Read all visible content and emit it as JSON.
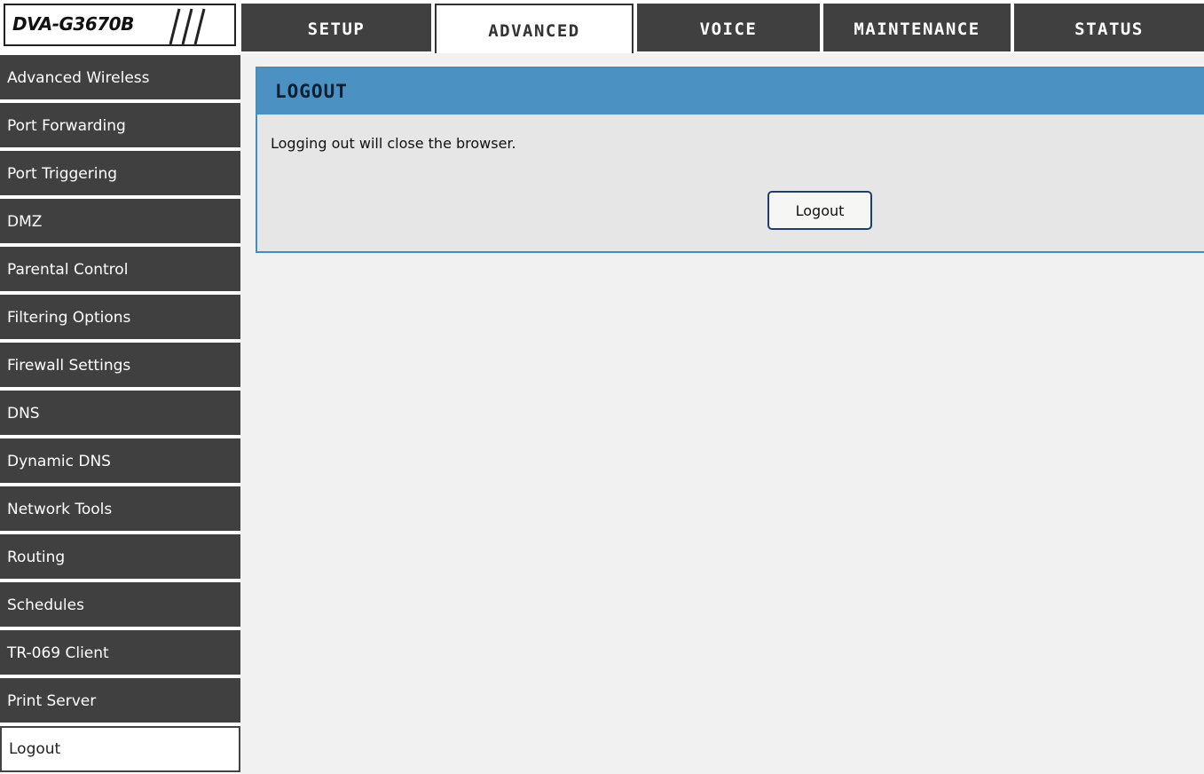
{
  "header": {
    "logo_text": "DVA-G3670B",
    "tabs": [
      {
        "label": "SETUP",
        "active": false
      },
      {
        "label": "ADVANCED",
        "active": true
      },
      {
        "label": "VOICE",
        "active": false
      },
      {
        "label": "MAINTENANCE",
        "active": false
      },
      {
        "label": "STATUS",
        "active": false
      }
    ]
  },
  "sidebar": {
    "items": [
      {
        "label": "Advanced Wireless",
        "active": false
      },
      {
        "label": "Port Forwarding",
        "active": false
      },
      {
        "label": "Port Triggering",
        "active": false
      },
      {
        "label": "DMZ",
        "active": false
      },
      {
        "label": "Parental Control",
        "active": false
      },
      {
        "label": "Filtering Options",
        "active": false
      },
      {
        "label": "Firewall Settings",
        "active": false
      },
      {
        "label": "DNS",
        "active": false
      },
      {
        "label": "Dynamic DNS",
        "active": false
      },
      {
        "label": "Network Tools",
        "active": false
      },
      {
        "label": "Routing",
        "active": false
      },
      {
        "label": "Schedules",
        "active": false
      },
      {
        "label": "TR-069 Client",
        "active": false
      },
      {
        "label": "Print Server",
        "active": false
      },
      {
        "label": "Logout",
        "active": true
      }
    ]
  },
  "main": {
    "panel_title": "LOGOUT",
    "message": "Logging out will close the browser.",
    "logout_button_label": "Logout"
  },
  "colors": {
    "nav_background": "#404040",
    "panel_header": "#4b92c3",
    "panel_body": "#e6e6e6",
    "page_background": "#f1f1f1"
  }
}
